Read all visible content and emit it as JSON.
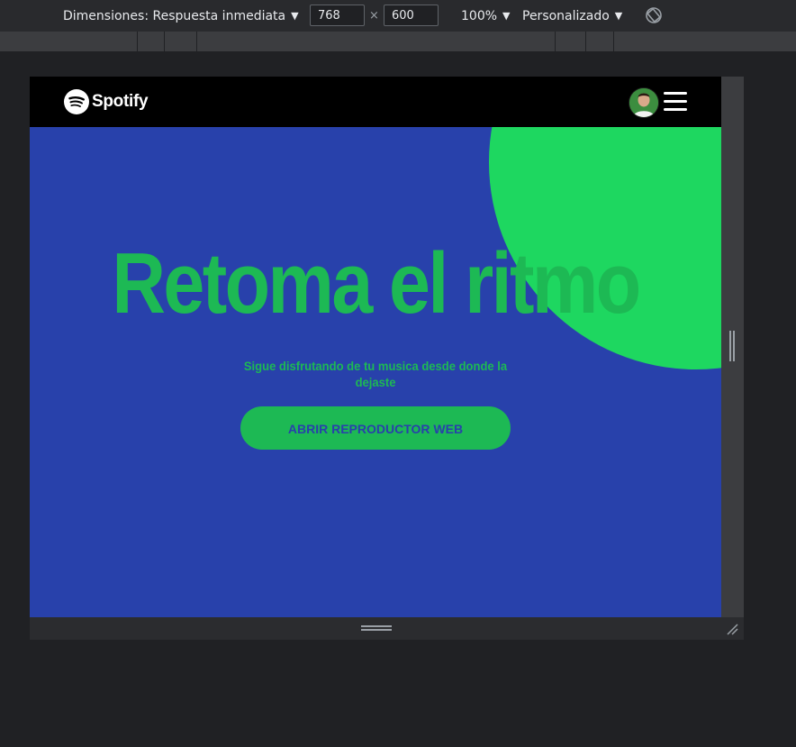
{
  "toolbar": {
    "dimensions_label": "Dimensiones: Respuesta inmediata",
    "width_value": "768",
    "times": "×",
    "height_value": "600",
    "zoom": "100%",
    "throttling": "Personalizado",
    "caret": "▼",
    "rotate_icon": "rotate-icon"
  },
  "site": {
    "brand": "Spotify",
    "hero_title": "Retoma el ritmo",
    "hero_subtitle": "Sigue disfrutando de tu musica desde donde la dejaste",
    "cta_label": "ABRIR REPRODUCTOR WEB",
    "colors": {
      "background": "#2841ab",
      "circle": "#1ed760",
      "title": "#1db954",
      "navbar": "#000000"
    }
  }
}
